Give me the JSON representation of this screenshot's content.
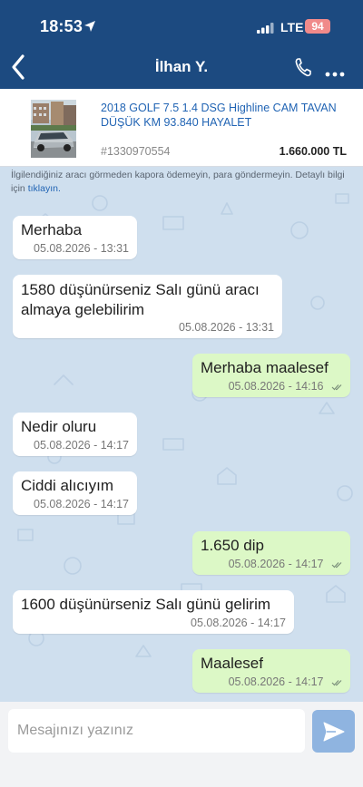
{
  "status_bar": {
    "time": "18:53",
    "network": "LTE",
    "battery": "94"
  },
  "header": {
    "contact_name": "İlhan Y."
  },
  "listing": {
    "title": "2018 GOLF 7.5 1.4 DSG Highline CAM TAVAN DÜŞÜK KM 93.840 HAYALET",
    "id": "#1330970554",
    "price": "1.660.000 TL"
  },
  "warning": {
    "text": "İlgilendiğiniz aracı görmeden kapora ödemeyin, para göndermeyin. Detaylı bilgi için",
    "link": "tıklayın."
  },
  "messages": [
    {
      "direction": "in",
      "lines": [
        "Merhaba"
      ],
      "time": "05.08.2026 - 13:31"
    },
    {
      "direction": "in",
      "lines": [
        "1580 düşünürseniz Salı günü aracı",
        "almaya gelebilirim"
      ],
      "time": "05.08.2026 - 13:31"
    },
    {
      "direction": "out",
      "lines": [
        "Merhaba maalesef"
      ],
      "time": "05.08.2026 - 14:16"
    },
    {
      "direction": "in",
      "lines": [
        "Nedir oluru"
      ],
      "time": "05.08.2026 - 14:17"
    },
    {
      "direction": "in",
      "lines": [
        "Ciddi alıcıyım"
      ],
      "time": "05.08.2026 - 14:17"
    },
    {
      "direction": "out",
      "lines": [
        "1.650 dip"
      ],
      "time": "05.08.2026 - 14:17"
    },
    {
      "direction": "in",
      "lines": [
        "1600 düşünürseniz Salı günü gelirim"
      ],
      "time": "05.08.2026 - 14:17"
    },
    {
      "direction": "out",
      "lines": [
        "Maalesef"
      ],
      "time": "05.08.2026 - 14:17"
    }
  ],
  "input": {
    "placeholder": "Mesajınızı yazınız"
  },
  "colors": {
    "header_bg": "#1c4a80",
    "outgoing_bubble": "#dcf8c6",
    "incoming_bubble": "#ffffff",
    "link": "#2164b4",
    "send_button": "#8fb4e0"
  },
  "icons": [
    "location-arrow-icon",
    "signal-icon",
    "battery-icon",
    "back-chevron-icon",
    "phone-icon",
    "more-icon",
    "double-check-icon",
    "send-icon"
  ]
}
